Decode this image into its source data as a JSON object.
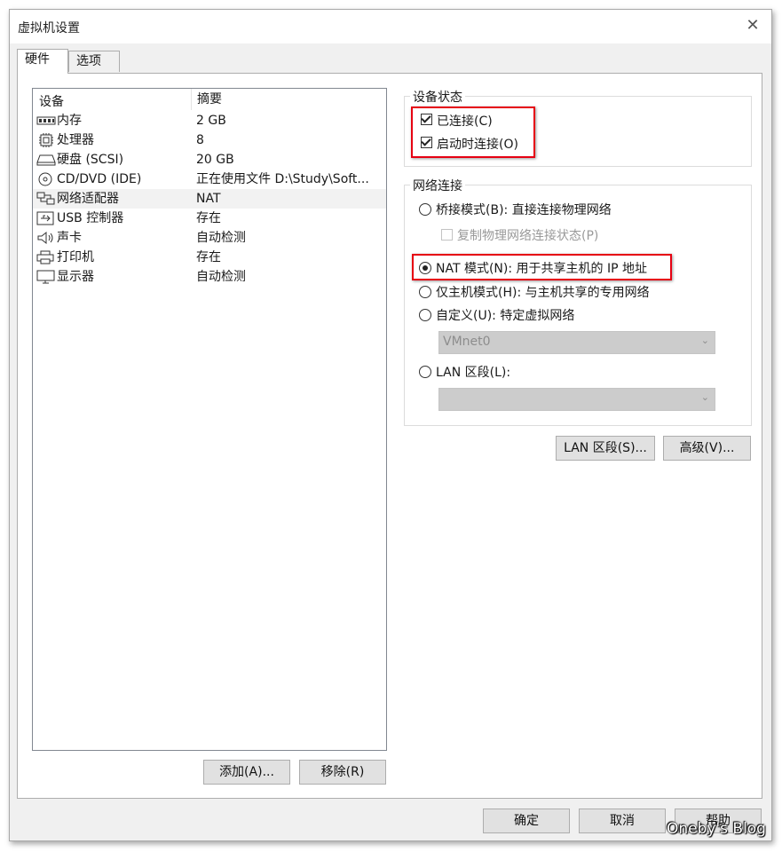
{
  "window": {
    "title": "虚拟机设置",
    "close_glyph": "✕"
  },
  "tabs": [
    {
      "label": "硬件",
      "active": true
    },
    {
      "label": "选项",
      "active": false
    }
  ],
  "device_list": {
    "col_device": "设备",
    "col_summary": "摘要",
    "rows": [
      {
        "name": "内存",
        "summary": "2 GB",
        "icon": "memory-icon"
      },
      {
        "name": "处理器",
        "summary": "8",
        "icon": "processor-icon"
      },
      {
        "name": "硬盘 (SCSI)",
        "summary": "20 GB",
        "icon": "hard-disk-icon"
      },
      {
        "name": "CD/DVD (IDE)",
        "summary": "正在使用文件 D:\\Study\\Soft...",
        "icon": "cd-dvd-icon"
      },
      {
        "name": "网络适配器",
        "summary": "NAT",
        "icon": "network-adapter-icon",
        "selected": true
      },
      {
        "name": "USB 控制器",
        "summary": "存在",
        "icon": "usb-icon"
      },
      {
        "name": "声卡",
        "summary": "自动检测",
        "icon": "sound-card-icon"
      },
      {
        "name": "打印机",
        "summary": "存在",
        "icon": "printer-icon"
      },
      {
        "name": "显示器",
        "summary": "自动检测",
        "icon": "display-icon"
      }
    ]
  },
  "buttons": {
    "add": "添加(A)...",
    "remove": "移除(R)",
    "lan_segments": "LAN 区段(S)...",
    "advanced": "高级(V)...",
    "ok": "确定",
    "cancel": "取消",
    "help": "帮助"
  },
  "device_status": {
    "title": "设备状态",
    "connected": {
      "label": "已连接(C)",
      "checked": true
    },
    "connect_at_power_on": {
      "label": "启动时连接(O)",
      "checked": true
    }
  },
  "network_connection": {
    "title": "网络连接",
    "bridged": {
      "label": "桥接模式(B): 直接连接物理网络",
      "selected": false
    },
    "replicate": {
      "label": "复制物理网络连接状态(P)",
      "checked": false,
      "enabled": false
    },
    "nat": {
      "label": "NAT 模式(N): 用于共享主机的 IP 地址",
      "selected": true
    },
    "host_only": {
      "label": "仅主机模式(H): 与主机共享的专用网络",
      "selected": false
    },
    "custom": {
      "label": "自定义(U): 特定虚拟网络",
      "selected": false
    },
    "custom_value": "VMnet0",
    "lan_segment": {
      "label": "LAN 区段(L):",
      "selected": false
    },
    "lan_segment_value": ""
  },
  "watermark": "Oneby's Blog",
  "colors": {
    "highlight_box": "#e60012",
    "selected_row": "#f2f2f2",
    "disabled_combo": "#cccccc"
  }
}
